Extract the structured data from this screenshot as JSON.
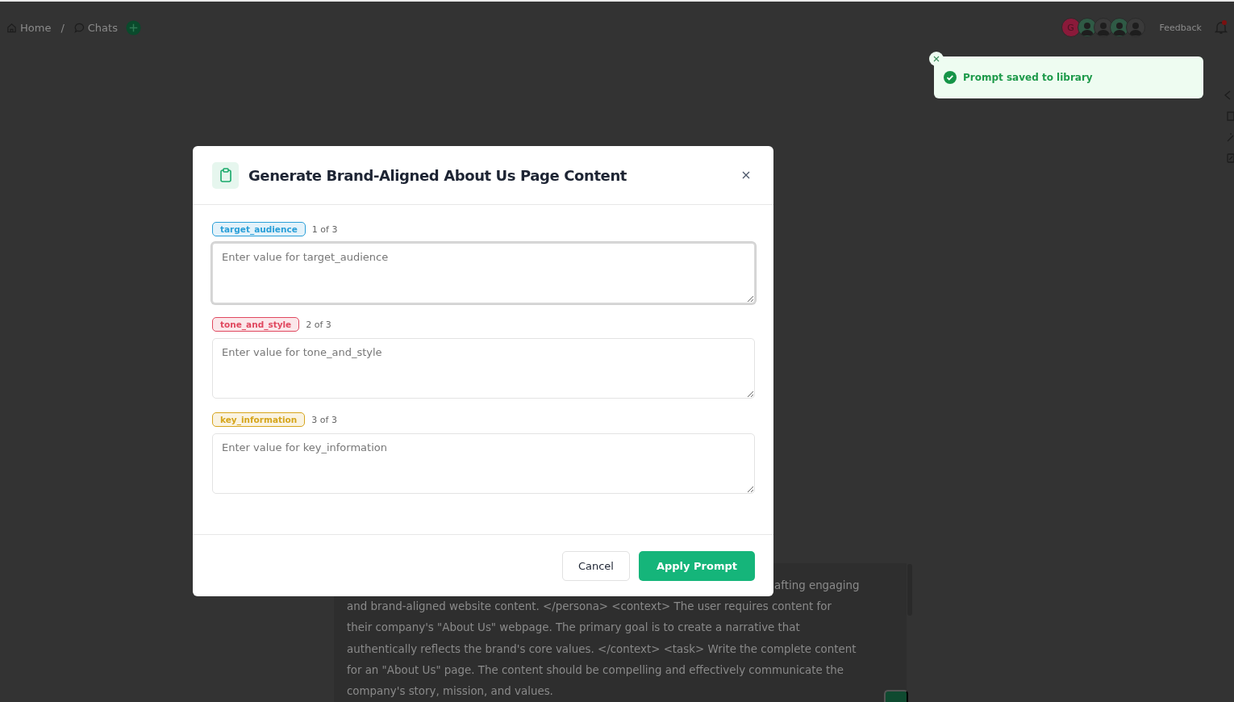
{
  "breadcrumb": [
    {
      "label": "Home",
      "kind": "home"
    },
    {
      "label": "Chats",
      "kind": "chat"
    }
  ],
  "breadcrumb_separator": "/",
  "avatars": [
    {
      "kind": "initial",
      "initial": "G",
      "color": "#8a1a3a"
    },
    {
      "kind": "person",
      "color": "#2f5a45"
    },
    {
      "kind": "person",
      "color": "#3a3a3a"
    },
    {
      "kind": "person",
      "color": "#2f5a45"
    },
    {
      "kind": "person",
      "color": "#3a3a3a"
    }
  ],
  "feedback": "Feedback",
  "toast": {
    "message": "Prompt saved to library"
  },
  "prompt_lines": [
    "afting engaging",
    "and brand-aligned website content. </persona> <context> The user requires content for",
    "their company's \"About Us\" webpage. The primary goal is to create a narrative that",
    "authentically reflects the brand's core values. </context> <task> Write the complete content",
    "for an \"About Us\" page. The content should be compelling and effectively communicate the",
    "company's story, mission, and values."
  ],
  "dialog": {
    "title": "Generate Brand-Aligned About Us Page Content",
    "variables": [
      {
        "name": "target_audience",
        "position": "1 of 3",
        "placeholder": "Enter value for target_audience",
        "color": "#2a9fd8",
        "focused": true
      },
      {
        "name": "tone_and_style",
        "position": "2 of 3",
        "placeholder": "Enter value for tone_and_style",
        "color": "#e0485f",
        "focused": false
      },
      {
        "name": "key_information",
        "position": "3 of 3",
        "placeholder": "Enter value for key_information",
        "color": "#d6a51c",
        "focused": false
      }
    ],
    "buttons": [
      {
        "label": "Cancel",
        "kind": "secondary"
      },
      {
        "label": "Apply Prompt",
        "kind": "primary"
      }
    ]
  }
}
